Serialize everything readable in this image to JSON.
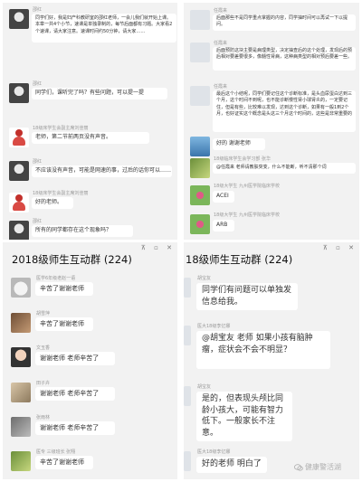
{
  "panel_tl": {
    "messages": [
      {
        "sender": "邵红",
        "text": "同学们好，我是妇产科教研室的邵红老师，一会儿我们就开始上课。本章一共4个小节，速课是单独录制的，每节后面都有习题。大家看2个速课，请大家注意。速课时间约50分钟，请大家……"
      },
      {
        "sender": "邵红",
        "text": "同学们，课听完了吗？有些问题，可以提一提"
      },
      {
        "sender": "18级床学生会副主席刘佳丽",
        "text": "老师，第二节前两页没有声音。"
      },
      {
        "sender": "邵红",
        "text": "不应该没有声音，可能是网速的事，过后的话你可以……"
      },
      {
        "sender": "18级床学生会副主席刘佳丽",
        "text": "好的老师。"
      },
      {
        "sender": "邵红",
        "text": "所有的同学都存在这个现象吗？"
      }
    ]
  },
  "panel_tr": {
    "messages": [
      {
        "sender": "任霞来",
        "text": "后面那些不是同学重点掌握的内容，同学抽时间可以再试一下以提问。"
      },
      {
        "sender": "任霞来",
        "text": "后面预防这块主要是病理类型，决定抽查后的这个处理，发现后的预后相对要差要很多，像髓性肾病，这种病类型的相对预后要差一些。"
      },
      {
        "sender": "任霞来",
        "text": "最后这个小结呢，同学们要记住这个诊断标准，是头血尿蛋白达到三个月，这个时间不到呢，也不能诊断慢性肾小球肾炎的，一定要记住，但是有些，比较难以发现，达到这个诊断，如果有一般1到2个月，也好证实这个概念是头这三个月这个时间的，这些是非常重要的"
      },
      {
        "sender": "",
        "text": "好的 谢谢老师"
      },
      {
        "sender": "18级临床学生会学习部 张华",
        "text": "@任霞来 老师请教肤突变，什么不能断，听不清那个词"
      },
      {
        "sender": "18级大学生 九州医学院临床学校",
        "text": "ACEI"
      },
      {
        "sender": "18级大学生 九州医学院临床学校",
        "text": "ARB"
      }
    ]
  },
  "panel_bl": {
    "title": "2018级师生互动群 (224)",
    "tools": [
      "⊼",
      "▫",
      "✕"
    ],
    "messages": [
      {
        "sender": "医学6年级老赵一语",
        "text": "辛苦了谢谢老师"
      },
      {
        "sender": "胡雪萍",
        "text": "辛苦了谢谢老师"
      },
      {
        "sender": "文玉香",
        "text": "谢谢老师 老师辛苦了"
      },
      {
        "sender": "田子卉",
        "text": "谢谢老师 老师辛苦了"
      },
      {
        "sender": "张雨林",
        "text": "谢谢老师 老师辛苦了"
      },
      {
        "sender": "医专 三级班长 张翔",
        "text": "辛苦了谢谢老师"
      }
    ]
  },
  "panel_br": {
    "title": "18级师生互动群 (224)",
    "tools": [
      "⊼",
      "▫",
      "✕"
    ],
    "messages": [
      {
        "sender": "胡宝友",
        "text": "同学们有问题可以单独发信息给我。"
      },
      {
        "sender": "医大18级李亿娜",
        "text": "@胡宝友 老师 如果小孩有脑肿瘤，症状会不会不明显？"
      },
      {
        "sender": "胡宝友",
        "text": "是的，但表现头颅比同龄小孩大，可能有智力低下。一般家长不注意。"
      },
      {
        "sender": "医大18级李亿娜",
        "text": "好的老师 明白了"
      }
    ],
    "watermark": "健康警活湖"
  }
}
